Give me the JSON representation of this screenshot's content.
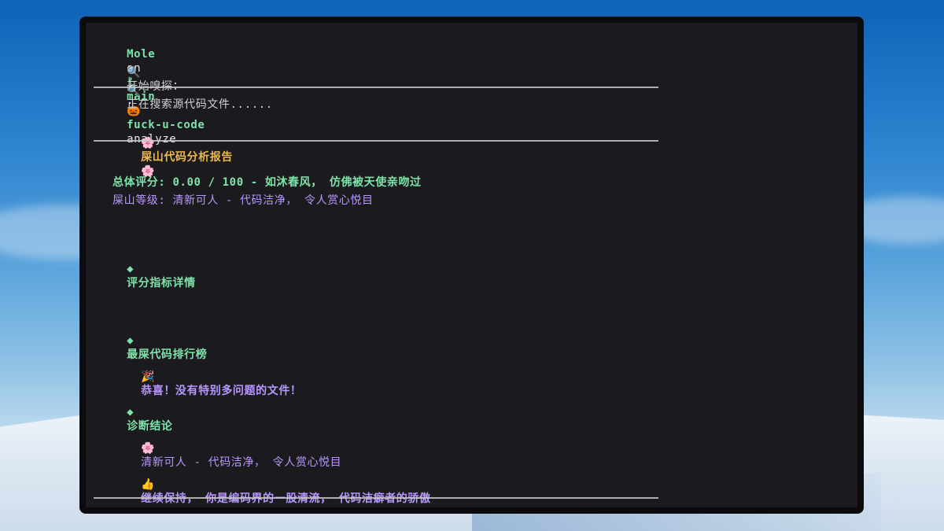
{
  "prompt": {
    "user": "Mole",
    "on_text": "on",
    "branch_icon": "git-branch-icon",
    "branch": "main",
    "pumpkin_icon": "pumpkin-icon",
    "command_name": "fuck-u-code",
    "command_arg": "analyze"
  },
  "messages": {
    "start_probe": "开始嗅探：",
    "start_probe_path": ".",
    "searching": "正在搜索源代码文件......"
  },
  "report": {
    "title": "屎山代码分析报告",
    "flower_icon": "blossom-icon",
    "score_line": "总体评分: 0.00 / 100 - 如沐春风， 仿佛被天使亲吻过",
    "level_line": "屎山等级: 清新可人 - 代码洁净， 令人赏心悦目",
    "metrics_title": "评分指标详情",
    "ranking_title": "最屎代码排行榜",
    "ranking_message": "恭喜！没有特别多问题的文件！",
    "diagnosis_title": "诊断结论",
    "diagnosis_level": "清新可人 - 代码洁净， 令人赏心悦目",
    "diagnosis_advice": "继续保持， 你是编码界的一股清流， 代码洁癖者的骄傲"
  },
  "icons": {
    "search": "search-icon",
    "celebrate": "party-popper-icon",
    "thumbs_up": "thumbs-up-icon",
    "diamond": "diamond-bullet-icon"
  },
  "colors": {
    "prompt_green": "#7ee3a9",
    "text_purple": "#b996ff",
    "title_orange": "#f0b84b",
    "terminal_bg": "#1b1b1f"
  }
}
